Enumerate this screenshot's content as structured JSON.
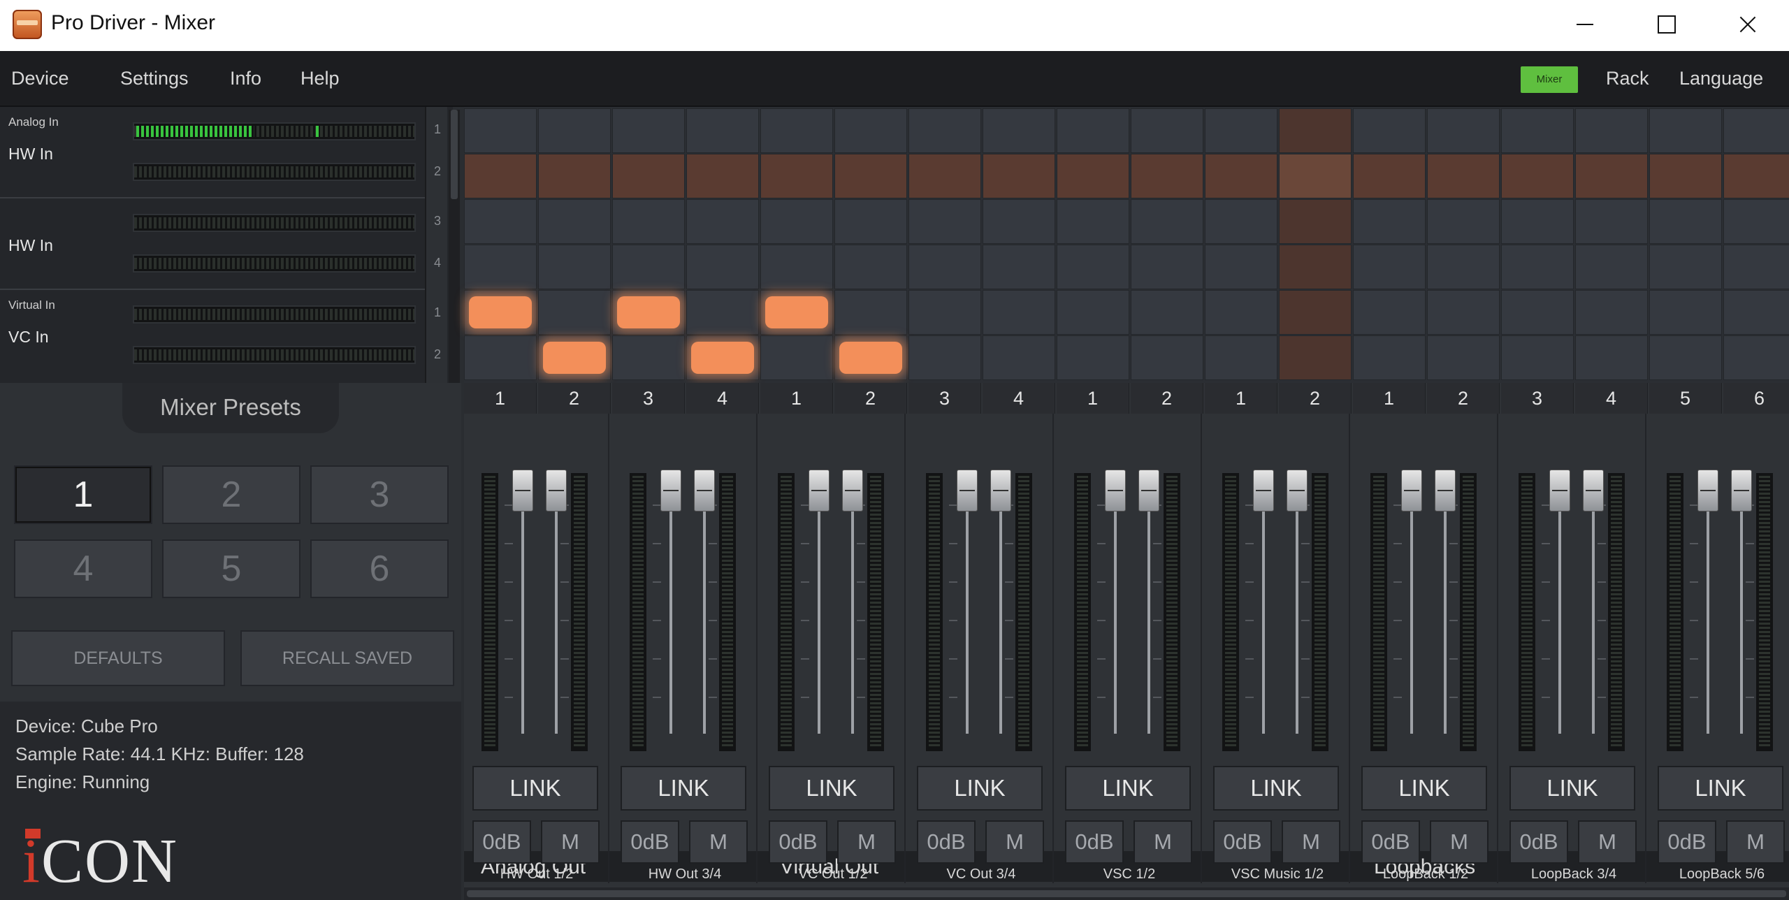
{
  "window": {
    "title": "Pro Driver - Mixer"
  },
  "menu": {
    "items": [
      "Device",
      "Settings",
      "Info",
      "Help"
    ],
    "right": {
      "mixer": "Mixer",
      "rack": "Rack",
      "language": "Language"
    }
  },
  "inputs": [
    {
      "category": "Analog In",
      "name": "HW In",
      "channels": [
        "1",
        "2"
      ],
      "levels": [
        0.42,
        0.0
      ],
      "peak": 0.65
    },
    {
      "category": "",
      "name": "HW In",
      "channels": [
        "3",
        "4"
      ],
      "levels": [
        0.0,
        0.0
      ],
      "peak": null
    },
    {
      "category": "Virtual In",
      "name": "VC In",
      "channels": [
        "1",
        "2"
      ],
      "levels": [
        0.0,
        0.0
      ],
      "peak": null
    }
  ],
  "matrix": {
    "active_cells": [
      [
        4,
        0
      ],
      [
        5,
        1
      ],
      [
        4,
        2
      ],
      [
        5,
        3
      ],
      [
        4,
        4
      ],
      [
        5,
        5
      ]
    ]
  },
  "output_channels": [
    "1",
    "2",
    "3",
    "4",
    "1",
    "2",
    "3",
    "4",
    "1",
    "2",
    "1",
    "2",
    "1",
    "2",
    "3",
    "4",
    "5",
    "6"
  ],
  "presets": {
    "title": "Mixer Presets",
    "buttons": [
      "1",
      "2",
      "3",
      "4",
      "5",
      "6"
    ],
    "active": "1",
    "defaults_label": "DEFAULTS",
    "recall_label": "RECALL SAVED"
  },
  "status": {
    "device": "Device: Cube Pro",
    "rate": "Sample Rate: 44.1 KHz:  Buffer: 128",
    "engine": "Engine: Running"
  },
  "logo": "iCON",
  "strips": [
    {
      "name": "HW Out  1/2",
      "link": "LINK",
      "zero": "0dB",
      "mute": "M"
    },
    {
      "name": "HW Out  3/4",
      "link": "LINK",
      "zero": "0dB",
      "mute": "M"
    },
    {
      "name": "VC Out  1/2",
      "link": "LINK",
      "zero": "0dB",
      "mute": "M"
    },
    {
      "name": "VC Out  3/4",
      "link": "LINK",
      "zero": "0dB",
      "mute": "M"
    },
    {
      "name": "VSC 1/2",
      "link": "LINK",
      "zero": "0dB",
      "mute": "M"
    },
    {
      "name": "VSC Music 1/2",
      "link": "LINK",
      "zero": "0dB",
      "mute": "M"
    },
    {
      "name": "LoopBack 1/2",
      "link": "LINK",
      "zero": "0dB",
      "mute": "M"
    },
    {
      "name": "LoopBack 3/4",
      "link": "LINK",
      "zero": "0dB",
      "mute": "M"
    },
    {
      "name": "LoopBack 5/6",
      "link": "LINK",
      "zero": "0dB",
      "mute": "M"
    }
  ],
  "sections": {
    "analog_out": "Analog Out",
    "virtual_out": "Virtual Out",
    "loopbacks": "Loopbacks"
  }
}
